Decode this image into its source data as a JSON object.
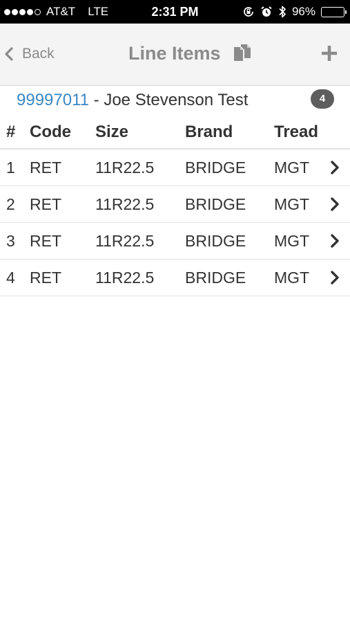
{
  "status_bar": {
    "carrier": "AT&T",
    "network": "LTE",
    "time": "2:31 PM",
    "battery_percent_label": "96%",
    "battery_level": 0.96,
    "icons": [
      "signal-dots-icon",
      "orientation-lock-icon",
      "alarm-icon",
      "bluetooth-icon",
      "battery-icon"
    ]
  },
  "nav": {
    "back_label": "Back",
    "title": "Line Items",
    "icons": {
      "back": "chevron-left-icon",
      "copy": "copy-documents-icon",
      "add": "plus-icon"
    }
  },
  "order": {
    "number": "99997011",
    "separator": " - ",
    "customer": "Joe Stevenson Test",
    "count": "4"
  },
  "table": {
    "headers": {
      "num": "#",
      "code": "Code",
      "size": "Size",
      "brand": "Brand",
      "tread": "Tread"
    },
    "rows": [
      {
        "num": "1",
        "code": "RET",
        "size": "11R22.5",
        "brand": "BRIDGE",
        "tread": "MGT"
      },
      {
        "num": "2",
        "code": "RET",
        "size": "11R22.5",
        "brand": "BRIDGE",
        "tread": "MGT"
      },
      {
        "num": "3",
        "code": "RET",
        "size": "11R22.5",
        "brand": "BRIDGE",
        "tread": "MGT"
      },
      {
        "num": "4",
        "code": "RET",
        "size": "11R22.5",
        "brand": "BRIDGE",
        "tread": "MGT"
      }
    ],
    "row_icon": "chevron-right-icon"
  },
  "colors": {
    "link": "#3a87c4",
    "nav_text": "#8b8b8b",
    "badge": "#5e5e5e",
    "nav_background": "#f4f4f4"
  }
}
